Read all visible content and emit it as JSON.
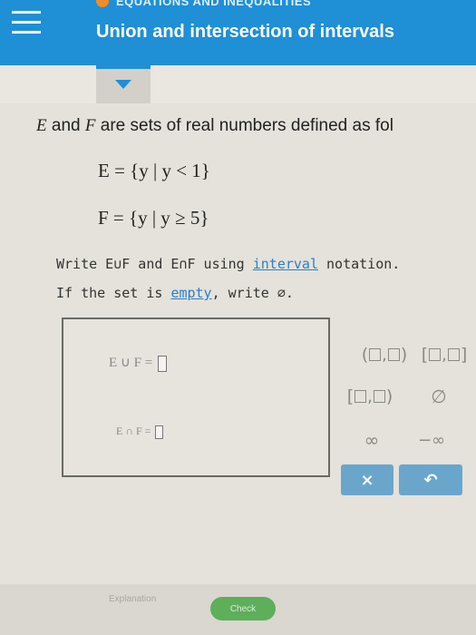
{
  "header": {
    "topic": "EQUATIONS AND INEQUALITIES",
    "title": "Union and intersection of intervals"
  },
  "problem": {
    "intro_prefix": " and ",
    "intro_suffix": " are sets of real numbers defined as fol",
    "var_e": "E",
    "var_f": "F",
    "set_e": "E = {y | y < 1}",
    "set_f": "F = {y | y ≥ 5}"
  },
  "instructions": {
    "line1_a": "Write E∪F and E∩F using ",
    "line1_link": "interval",
    "line1_b": " notation.",
    "line2_a": "If the set is ",
    "line2_link": "empty",
    "line2_b": ", write ∅."
  },
  "answer": {
    "union_label": "E ∪ F =",
    "intersection_label": "E ∩ F ="
  },
  "keypad": {
    "open_open": "(□,□)",
    "closed_closed": "[□,□]",
    "closed_open": "[□,□)",
    "empty_set": "∅",
    "infinity": "∞",
    "neg_infinity": "−∞",
    "clear": "×",
    "undo": "↶"
  },
  "footer": {
    "explanation": "Explanation",
    "check": "Check"
  },
  "colors": {
    "header": "#1f8fd6",
    "link": "#2b7fc8",
    "action": "#6aa6cc",
    "check": "#5fae5c"
  }
}
